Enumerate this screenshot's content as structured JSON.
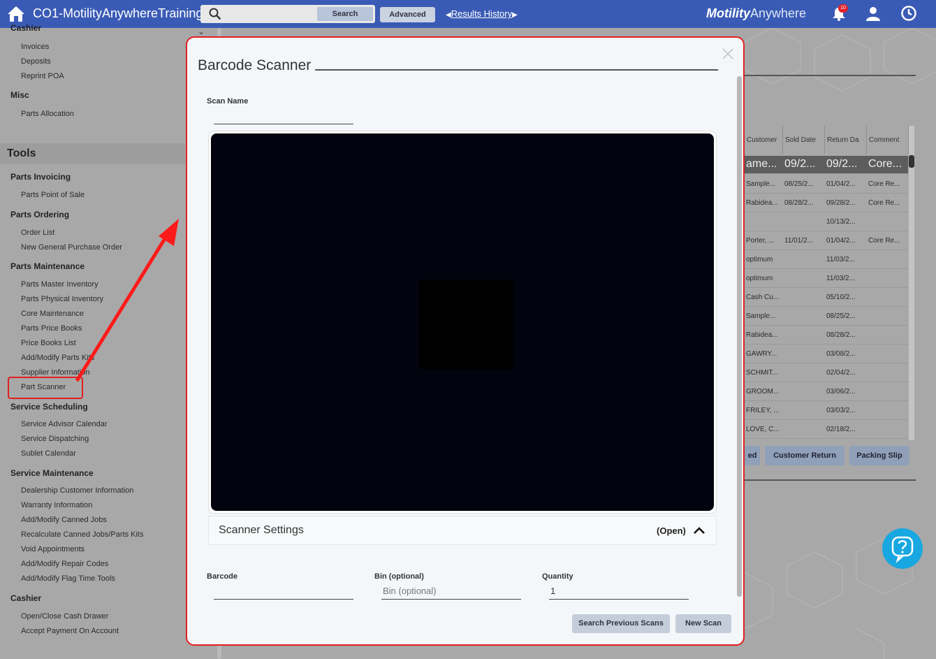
{
  "topbar": {
    "title": "CO1-MotilityAnywhereTraining",
    "search_placeholder": "",
    "search_button": "Search",
    "advanced_button": "Advanced",
    "results_history": "Results History",
    "brand_bold": "Motility",
    "brand_light": "Anywhere",
    "notification_count": "10"
  },
  "sidebar": {
    "partial_heading": "Cashier",
    "top_items": [
      "Invoices",
      "Deposits",
      "Reprint POA"
    ],
    "misc_heading": "Misc",
    "misc_items": [
      "Parts Allocation"
    ],
    "tools_heading": "Tools",
    "sections": [
      {
        "heading": "Parts Invoicing",
        "items": [
          "Parts Point of Sale"
        ]
      },
      {
        "heading": "Parts Ordering",
        "items": [
          "Order List",
          "New General Purchase Order"
        ]
      },
      {
        "heading": "Parts Maintenance",
        "items": [
          "Parts Master Inventory",
          "Parts Physical Inventory",
          "Core Maintenance",
          "Parts Price Books",
          "Price Books List",
          "Add/Modify Parts Kits",
          "Supplier Information",
          "Part Scanner"
        ]
      },
      {
        "heading": "Service Scheduling",
        "items": [
          "Service Advisor Calendar",
          "Service Dispatching",
          "Sublet Calendar"
        ]
      },
      {
        "heading": "Service Maintenance",
        "items": [
          "Dealership Customer Information",
          "Warranty Information",
          "Add/Modify Canned Jobs",
          "Recalculate Canned Jobs/Parts Kits",
          "Void Appointments",
          "Add/Modify Repair Codes",
          "Add/Modify Flag Time Tools"
        ]
      },
      {
        "heading": "Cashier",
        "items": [
          "Open/Close Cash Drawer",
          "Accept Payment On Account"
        ]
      }
    ]
  },
  "background_table": {
    "columns": [
      "Customer",
      "Sold Date",
      "Return Da",
      "Comment"
    ],
    "selected_row": [
      "ame...",
      "09/2...",
      "09/2...",
      "Core..."
    ],
    "rows": [
      [
        "Sample...",
        "08/25/2...",
        "01/04/2...",
        "Core Re..."
      ],
      [
        "Rabidea...",
        "08/28/2...",
        "09/28/2...",
        "Core Re..."
      ],
      [
        "",
        "",
        "10/13/2...",
        ""
      ],
      [
        "Porter, ...",
        "11/01/2...",
        "01/04/2...",
        "Core Re..."
      ],
      [
        "optimum",
        "",
        "11/03/2...",
        ""
      ],
      [
        "optimum",
        "",
        "11/03/2...",
        ""
      ],
      [
        "Cash Cu...",
        "",
        "05/10/2...",
        ""
      ],
      [
        "Sample...",
        "",
        "08/25/2...",
        ""
      ],
      [
        "Rabidea...",
        "",
        "08/28/2...",
        ""
      ],
      [
        "GAWRY...",
        "",
        "03/08/2...",
        ""
      ],
      [
        "SCHMIT...",
        "",
        "02/04/2...",
        ""
      ],
      [
        "GROOM...",
        "",
        "03/06/2...",
        ""
      ],
      [
        "FRILEY, ...",
        "",
        "03/03/2...",
        ""
      ],
      [
        "LOVE, C...",
        "",
        "02/18/2...",
        ""
      ]
    ],
    "buttons": [
      "ed",
      "Customer Return",
      "Packing Slip"
    ]
  },
  "modal": {
    "title": "Barcode Scanner",
    "scan_name_label": "Scan Name",
    "scan_name_value": "",
    "settings_label": "Scanner Settings",
    "settings_state": "(Open)",
    "barcode_label": "Barcode",
    "barcode_value": "",
    "bin_label": "Bin (optional)",
    "bin_placeholder": "Bin (optional)",
    "quantity_label": "Quantity",
    "quantity_value": "1",
    "search_previous_button": "Search Previous Scans",
    "new_scan_button": "New Scan"
  },
  "colors": {
    "topbar": "#3a5bb5",
    "highlight": "#e02020",
    "help": "#18a7e0"
  }
}
